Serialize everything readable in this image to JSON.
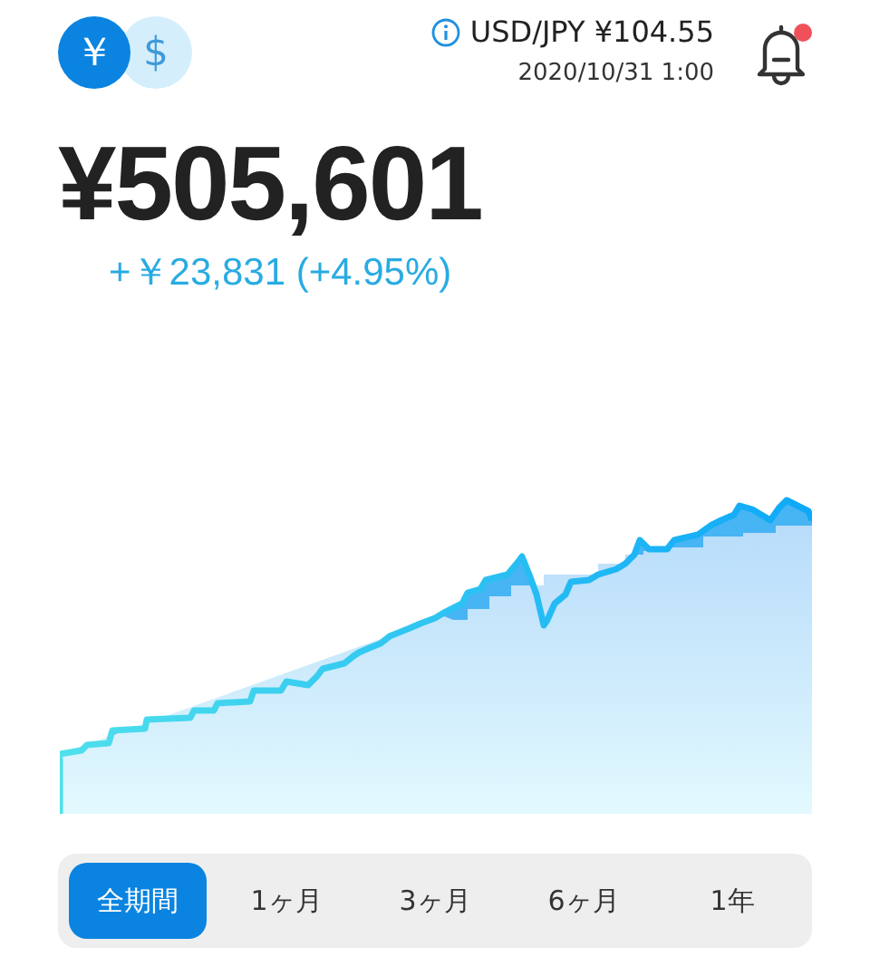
{
  "currency_toggle": [
    {
      "symbol": "￥",
      "selected": true
    },
    {
      "symbol": "$",
      "selected": false
    }
  ],
  "rate": {
    "label": "USD/JPY ¥104.55",
    "updated": "2020/10/31 1:00"
  },
  "alerts": {
    "unread": true
  },
  "balance": {
    "total": "¥505,601",
    "change": "+￥23,831 (+4.95%)"
  },
  "period_tabs": [
    {
      "label": "全期間",
      "selected": true
    },
    {
      "label": "1ヶ月",
      "selected": false
    },
    {
      "label": "3ヶ月",
      "selected": false
    },
    {
      "label": "6ヶ月",
      "selected": false
    },
    {
      "label": "1年",
      "selected": false
    }
  ]
}
